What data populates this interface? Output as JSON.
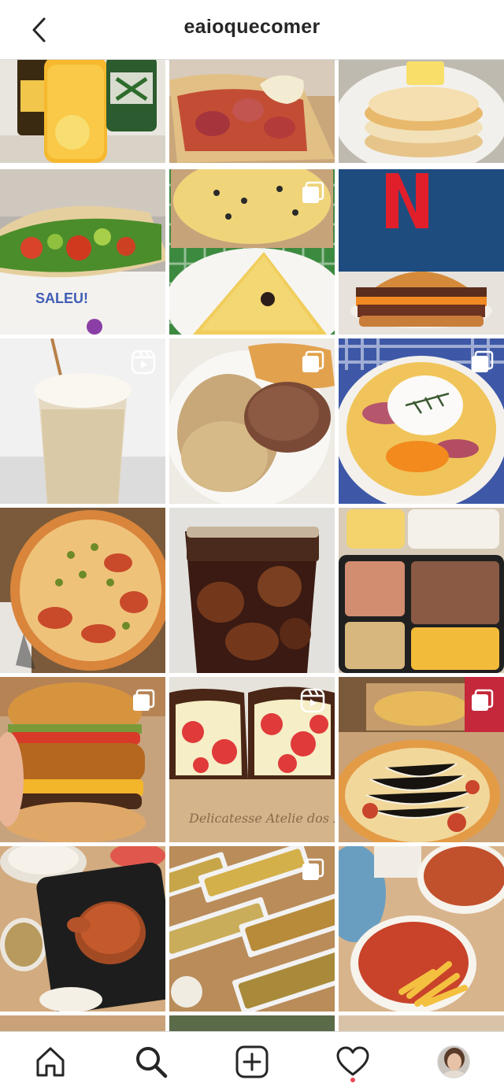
{
  "header": {
    "title": "eaioquecomer",
    "back_icon": "chevron-left-icon"
  },
  "posts": [
    {
      "subject": "orange juice pitcher and bottles",
      "type": "photo"
    },
    {
      "subject": "sausage sandwich with mayonnaise",
      "type": "photo"
    },
    {
      "subject": "pancakes with butter",
      "type": "photo"
    },
    {
      "subject": "wrap with salad",
      "type": "photo",
      "caption_text": "SALEU!"
    },
    {
      "subject": "pizza slices in box",
      "type": "carousel"
    },
    {
      "subject": "double cheeseburger",
      "type": "photo"
    },
    {
      "subject": "iced milkshake",
      "type": "reel"
    },
    {
      "subject": "steak with rice",
      "type": "carousel"
    },
    {
      "subject": "loaded fries with cream",
      "type": "carousel"
    },
    {
      "subject": "pizza with olives and corn",
      "type": "photo"
    },
    {
      "subject": "glass of cola",
      "type": "photo"
    },
    {
      "subject": "meal prep tray with beef and fries",
      "type": "photo"
    },
    {
      "subject": "crispy chicken burger",
      "type": "carousel"
    },
    {
      "subject": "strawberry chocolate egg",
      "type": "reel",
      "caption_text": "Delicatesse Atelie dos Doces"
    },
    {
      "subject": "pizza with shredded cheese",
      "type": "carousel"
    },
    {
      "subject": "roast chicken and sides",
      "type": "photo"
    },
    {
      "subject": "grilled zucchini trays",
      "type": "carousel"
    },
    {
      "subject": "pasta with fries and sauce",
      "type": "photo"
    }
  ],
  "tabbar": {
    "items": [
      {
        "name": "home",
        "icon": "home-icon"
      },
      {
        "name": "search",
        "icon": "search-icon",
        "active": true
      },
      {
        "name": "create",
        "icon": "add-post-icon"
      },
      {
        "name": "activity",
        "icon": "heart-icon",
        "has_notification": true
      },
      {
        "name": "profile",
        "icon": "avatar"
      }
    ]
  },
  "colors": {
    "text": "#262626",
    "border": "#dbdbdb",
    "notification": "#ed4956"
  }
}
